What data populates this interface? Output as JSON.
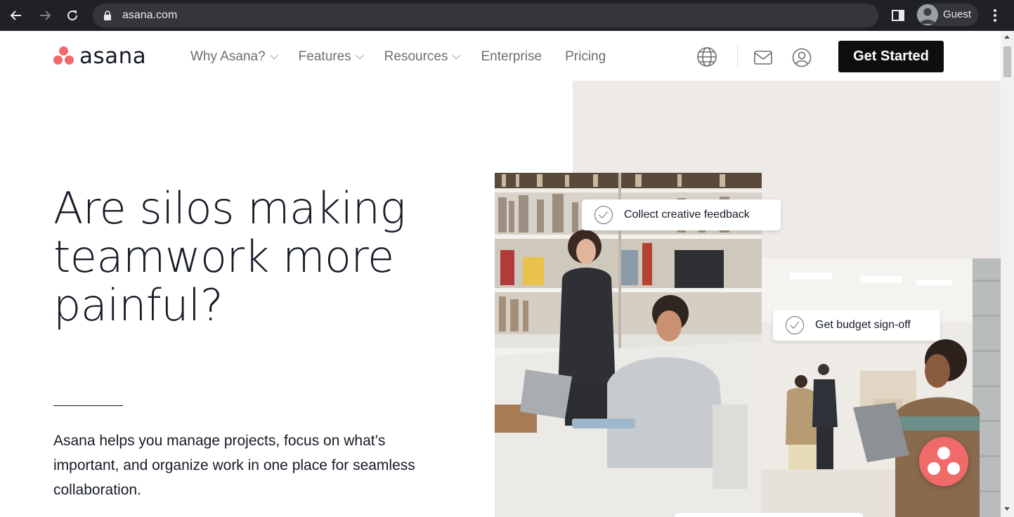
{
  "browser": {
    "url": "asana.com",
    "profile_name": "Guest"
  },
  "header": {
    "logo_text": "asana",
    "nav": [
      {
        "label": "Why Asana?",
        "has_dropdown": true
      },
      {
        "label": "Features",
        "has_dropdown": true
      },
      {
        "label": "Resources",
        "has_dropdown": true
      },
      {
        "label": "Enterprise",
        "has_dropdown": false
      },
      {
        "label": "Pricing",
        "has_dropdown": false
      }
    ],
    "cta_label": "Get Started"
  },
  "hero": {
    "title_lines": [
      "Are silos making",
      "teamwork more",
      "painful?"
    ],
    "description": "Asana helps you manage projects, focus on what’s important, and organize work in one place for seamless collaboration."
  },
  "task_cards": [
    {
      "label": "Collect creative feedback"
    },
    {
      "label": "Get budget sign-off"
    }
  ],
  "colors": {
    "brand": "#f06a6a",
    "text": "#151b26",
    "nav_text": "#6d6e6f",
    "cta_bg": "#0d0e10",
    "beige": "#edeae7"
  },
  "icons": {
    "back": "arrow-left-icon",
    "forward": "arrow-right-icon",
    "reload": "reload-icon",
    "lock": "lock-icon",
    "language": "globe-icon",
    "contact": "mail-icon",
    "account": "user-icon",
    "chat": "asana-chat-icon"
  }
}
